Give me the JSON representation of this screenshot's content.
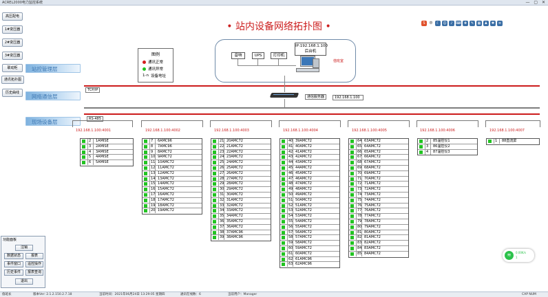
{
  "window": {
    "title": "ACREL2000电力监控系统"
  },
  "page_title": "• 站内设备网络拓扑图 •",
  "sidebar": [
    {
      "label": "高压配电"
    },
    {
      "label": "1#变压器"
    },
    {
      "label": "2#变压器"
    },
    {
      "label": "3#变压器"
    },
    {
      "label": "联动柜"
    },
    {
      "label": "通讯拓扑图"
    },
    {
      "label": "历史曲线"
    }
  ],
  "bands": {
    "station": "站控管理层",
    "network": "网络通信层",
    "field": "现场设备层"
  },
  "legend": {
    "title": "图例",
    "ok": "通讯正常",
    "fault": "通讯异常",
    "addr_key": "1-n",
    "addr": "设备地址",
    "color_ok": "#22c322",
    "color_fault": "#d41e1e"
  },
  "room": {
    "ip": "IP:192.168.1.100",
    "host": "后台机",
    "duty": "值班室",
    "audio": "音响",
    "ups": "UPS",
    "printer": "打印机"
  },
  "network": {
    "tcp": "TCP/IP",
    "server": "通信服务器",
    "server_ip": "192.168.1.100",
    "rs485": "RS-485"
  },
  "columns": [
    {
      "ip": "192.168.1.100:4001",
      "rows": [
        {
          "n": "2",
          "name": "1AMISE"
        },
        {
          "n": "3",
          "name": "2AMISE"
        },
        {
          "n": "4",
          "name": "3AMISE"
        },
        {
          "n": "5",
          "name": "4AMISE"
        },
        {
          "n": "6",
          "name": "5AMISE"
        }
      ]
    },
    {
      "ip": "192.168.1.100:4002",
      "rows": [
        {
          "n": "7",
          "name": "6AMC96"
        },
        {
          "n": "8",
          "name": "7AMC96"
        },
        {
          "n": "9",
          "name": "8AMC72"
        },
        {
          "n": "10",
          "name": "9AMC72"
        },
        {
          "n": "11",
          "name": "10AMC72"
        },
        {
          "n": "12",
          "name": "11AMC72"
        },
        {
          "n": "13",
          "name": "12AMC72"
        },
        {
          "n": "14",
          "name": "13AMC72"
        },
        {
          "n": "15",
          "name": "14AMC72"
        },
        {
          "n": "16",
          "name": "15AMC72"
        },
        {
          "n": "17",
          "name": "16AMC72"
        },
        {
          "n": "18",
          "name": "17AMC72"
        },
        {
          "n": "19",
          "name": "18AMC72"
        },
        {
          "n": "20",
          "name": "19AMC72"
        }
      ]
    },
    {
      "ip": "192.168.1.100:4003",
      "rows": [
        {
          "n": "21",
          "name": "20AMC72"
        },
        {
          "n": "22",
          "name": "21AMC72"
        },
        {
          "n": "23",
          "name": "22AMC72"
        },
        {
          "n": "24",
          "name": "23AMC72"
        },
        {
          "n": "25",
          "name": "24AMC72"
        },
        {
          "n": "26",
          "name": "25AMC72"
        },
        {
          "n": "27",
          "name": "26AMC72"
        },
        {
          "n": "28",
          "name": "27AMC72"
        },
        {
          "n": "29",
          "name": "28AMC72"
        },
        {
          "n": "30",
          "name": "29AMC72"
        },
        {
          "n": "31",
          "name": "30AMC72"
        },
        {
          "n": "32",
          "name": "31AMC72"
        },
        {
          "n": "33",
          "name": "32AMC72"
        },
        {
          "n": "34",
          "name": "33AMC72"
        },
        {
          "n": "35",
          "name": "34AMC72"
        },
        {
          "n": "36",
          "name": "35AMC72"
        },
        {
          "n": "37",
          "name": "36AMC72"
        },
        {
          "n": "38",
          "name": "37AMC96"
        },
        {
          "n": "39",
          "name": "38AMC96"
        }
      ]
    },
    {
      "ip": "192.168.1.100:4004",
      "rows": [
        {
          "n": "40",
          "name": "39AMC72"
        },
        {
          "n": "41",
          "name": "40AMC72"
        },
        {
          "n": "42",
          "name": "41AMC72"
        },
        {
          "n": "43",
          "name": "42AMC72"
        },
        {
          "n": "44",
          "name": "43AMC72"
        },
        {
          "n": "45",
          "name": "44AMC72"
        },
        {
          "n": "46",
          "name": "45AMC72"
        },
        {
          "n": "47",
          "name": "46AMC72"
        },
        {
          "n": "48",
          "name": "47AMC72"
        },
        {
          "n": "49",
          "name": "48AMC72"
        },
        {
          "n": "50",
          "name": "49AMC72"
        },
        {
          "n": "51",
          "name": "50AMC72"
        },
        {
          "n": "52",
          "name": "51AMC72"
        },
        {
          "n": "53",
          "name": "52AMC72"
        },
        {
          "n": "54",
          "name": "53AMC72"
        },
        {
          "n": "55",
          "name": "54AMC72"
        },
        {
          "n": "56",
          "name": "55AMC72"
        },
        {
          "n": "57",
          "name": "56AMC72"
        },
        {
          "n": "58",
          "name": "57AMC72"
        },
        {
          "n": "59",
          "name": "58AMC72"
        },
        {
          "n": "60",
          "name": "59AMC72"
        },
        {
          "n": "61",
          "name": "60AMC72"
        },
        {
          "n": "62",
          "name": "61AMC96"
        },
        {
          "n": "63",
          "name": "62AMC96"
        }
      ]
    },
    {
      "ip": "192.168.1.100:4005",
      "rows": [
        {
          "n": "64",
          "name": "63AMC72"
        },
        {
          "n": "65",
          "name": "64AMC72"
        },
        {
          "n": "66",
          "name": "65AMC72"
        },
        {
          "n": "67",
          "name": "66AMC72"
        },
        {
          "n": "68",
          "name": "67AMC72"
        },
        {
          "n": "69",
          "name": "68AMC72"
        },
        {
          "n": "70",
          "name": "69AMC72"
        },
        {
          "n": "71",
          "name": "70AMC72"
        },
        {
          "n": "72",
          "name": "71AMC72"
        },
        {
          "n": "73",
          "name": "72AMC72"
        },
        {
          "n": "74",
          "name": "73AMC72"
        },
        {
          "n": "75",
          "name": "74AMC72"
        },
        {
          "n": "76",
          "name": "75AMC72"
        },
        {
          "n": "77",
          "name": "76AMC72"
        },
        {
          "n": "78",
          "name": "77AMC72"
        },
        {
          "n": "79",
          "name": "78AMC72"
        },
        {
          "n": "80",
          "name": "79AMC72"
        },
        {
          "n": "81",
          "name": "80AMC72"
        },
        {
          "n": "82",
          "name": "81AMC72"
        },
        {
          "n": "83",
          "name": "82AMC72"
        },
        {
          "n": "84",
          "name": "83AMC72"
        },
        {
          "n": "85",
          "name": "84AMC72"
        }
      ]
    },
    {
      "ip": "192.168.1.100:4006",
      "rows": [
        {
          "n": "2",
          "name": "85温控仪1"
        },
        {
          "n": "3",
          "name": "86温控仪2"
        },
        {
          "n": "4",
          "name": "87温控仪3"
        }
      ]
    },
    {
      "ip": "192.168.1.100:4007",
      "rows": [
        {
          "n": "1",
          "name": "88直流屏"
        }
      ]
    }
  ],
  "panel": {
    "title": "功能面板",
    "login": "注销",
    "realtime": "数据状态",
    "report": "报表",
    "event": "事件窗口",
    "alarm": "遥控操作",
    "history": "历史事件",
    "query": "报表查询",
    "exit": "退出"
  },
  "widget": {
    "line1": "0.00K/s",
    "line2": "1"
  },
  "status": {
    "user": "值班长",
    "version": "版本Ver: 2.1.2.150.2.7.18",
    "time": "当前时间：2021年06月24日 13:29:05  星期四",
    "count": "通讯在线数：6",
    "operator": "当前用户：Manager",
    "caps": "CAP NUM"
  }
}
